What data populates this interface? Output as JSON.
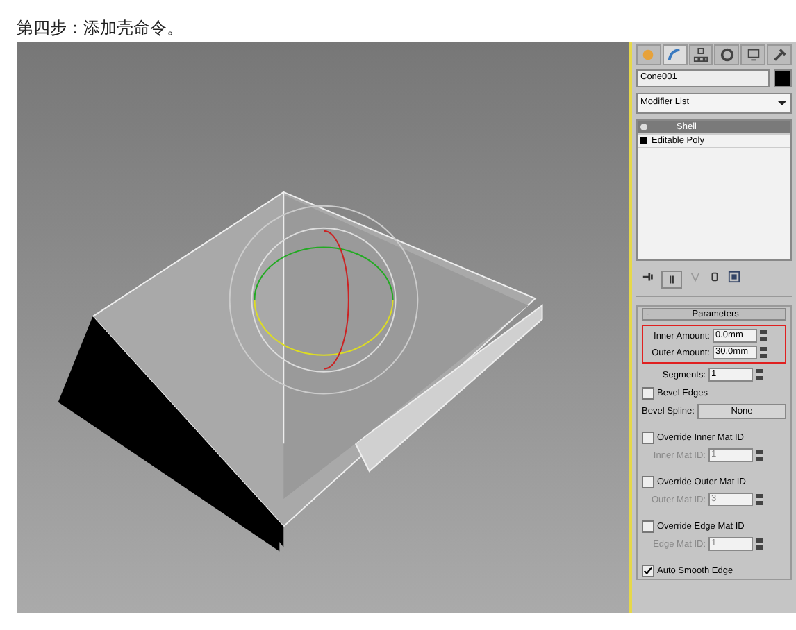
{
  "caption": "第四步：添加壳命令。",
  "command_tabs": [
    {
      "kind": "create",
      "selected": false
    },
    {
      "kind": "modify",
      "selected": true
    },
    {
      "kind": "hierarchy",
      "selected": false
    },
    {
      "kind": "motion",
      "selected": false
    },
    {
      "kind": "display",
      "selected": false
    },
    {
      "kind": "utilities",
      "selected": false
    }
  ],
  "object_name": "Cone001",
  "modifier_list": "Modifier List",
  "stack": [
    {
      "label": "Shell",
      "selected": true,
      "kind": "modifier"
    },
    {
      "label": "Editable Poly",
      "selected": false,
      "kind": "base"
    }
  ],
  "rollout": {
    "toggle": "-",
    "title": "Parameters",
    "amounts": [
      {
        "label": "Inner Amount:",
        "value": "0.0mm"
      },
      {
        "label": "Outer Amount:",
        "value": "30.0mm"
      }
    ],
    "rows": [
      {
        "kind": "spinner",
        "label": "Segments:",
        "value": "1",
        "disabled": false
      },
      {
        "kind": "check",
        "label": "Bevel Edges",
        "checked": false
      },
      {
        "kind": "button",
        "label": "Bevel Spline:",
        "value": "None"
      },
      {
        "kind": "check",
        "label": "Override Inner Mat ID",
        "checked": false
      },
      {
        "kind": "spinner",
        "label": "Inner Mat ID:",
        "value": "1",
        "disabled": true
      },
      {
        "kind": "check",
        "label": "Override Outer Mat ID",
        "checked": false
      },
      {
        "kind": "spinner",
        "label": "Outer Mat ID:",
        "value": "3",
        "disabled": true
      },
      {
        "kind": "check",
        "label": "Override Edge Mat ID",
        "checked": false
      },
      {
        "kind": "spinner",
        "label": "Edge Mat ID:",
        "value": "1",
        "disabled": true
      },
      {
        "kind": "check",
        "label": "Auto Smooth Edge",
        "checked": true
      }
    ]
  }
}
